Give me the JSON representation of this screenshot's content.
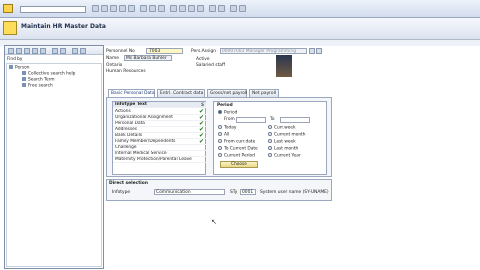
{
  "app": {
    "title": "Maintain HR Master Data"
  },
  "left_panel": {
    "find_by_label": "Find by",
    "tree": [
      {
        "label": "Person",
        "level": 0
      },
      {
        "label": "Collective search help",
        "level": 1
      },
      {
        "label": "Search Term",
        "level": 1
      },
      {
        "label": "Free search",
        "level": 1
      }
    ]
  },
  "header": {
    "personnel_no_label": "Personnel No",
    "personnel_no_value": "7003",
    "name_label": "Name",
    "name_value": "Ms Barbara Buhler",
    "line3": "Ontario",
    "line4": "Human Resources",
    "pers_assign_label": "Pers.Assign",
    "pers_assign_value": "00007003 Manager Programming",
    "status": "Active",
    "group": "Salaried staff"
  },
  "tabs": [
    {
      "label": "Basic Personal Data",
      "active": true
    },
    {
      "label": "Entrl. Contract data",
      "active": false
    },
    {
      "label": "Gross/net payroll",
      "active": false
    },
    {
      "label": "Net payroll",
      "active": false
    }
  ],
  "infotypes": {
    "header": "Infotype Text",
    "rows": [
      {
        "label": "Actions",
        "checked": true
      },
      {
        "label": "Organizational Assignment",
        "checked": true
      },
      {
        "label": "Personal Data",
        "checked": true
      },
      {
        "label": "Addresses",
        "checked": true
      },
      {
        "label": "Bank Details",
        "checked": true
      },
      {
        "label": "Family Member/Dependents",
        "checked": true
      },
      {
        "label": "Challenge",
        "checked": false
      },
      {
        "label": "Internal Medical Service",
        "checked": false
      },
      {
        "label": "Maternity Protection/Parental Leave",
        "checked": false
      }
    ]
  },
  "period": {
    "title": "Period",
    "options_left": [
      "Period",
      "Today",
      "All",
      "From curr.date",
      "To Current Date",
      "Current Period"
    ],
    "options_right": [
      "Curr.week",
      "Current month",
      "Last week",
      "Last month",
      "Current Year"
    ],
    "from_label": "From",
    "to_label": "To",
    "choose_label": "Choose"
  },
  "direct_selection": {
    "title": "Direct selection",
    "infotype_label": "Infotype",
    "infotype_value": "Communication",
    "sty_label": "STy",
    "sty_value": "0001",
    "sty_text": "System user name (SY-UNAME)"
  }
}
